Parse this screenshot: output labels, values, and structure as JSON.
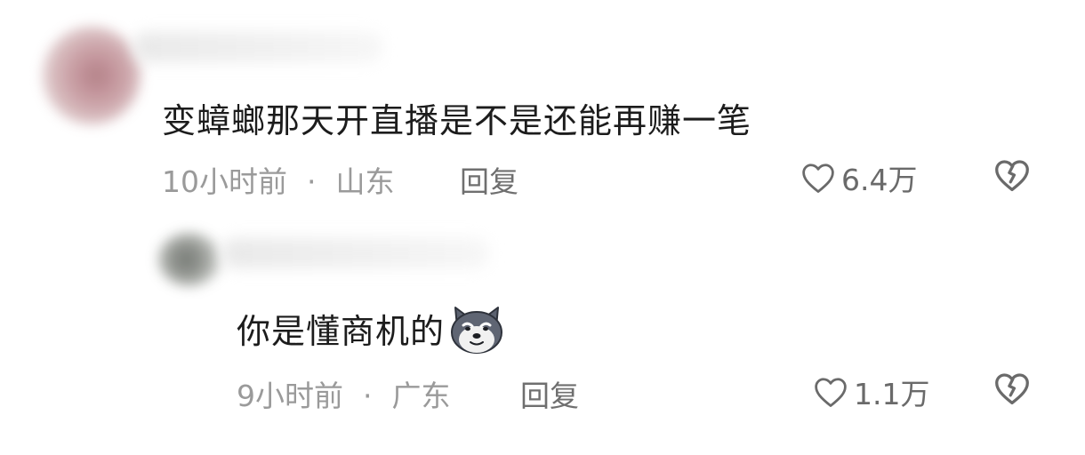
{
  "comments": [
    {
      "text": "变蟑螂那天开直播是不是还能再赚一笔",
      "time": "10小时前",
      "separator": "·",
      "location": "山东",
      "reply_label": "回复",
      "likes": "6.4万"
    },
    {
      "text": "你是懂商机的",
      "emoji": "dog-face-emoji",
      "time": "9小时前",
      "separator": "·",
      "location": "广东",
      "reply_label": "回复",
      "likes": "1.1万"
    }
  ],
  "icons": {
    "like": "heart-outline-icon",
    "dislike": "broken-heart-icon"
  },
  "colors": {
    "text": "#1c1c1c",
    "meta": "#9a9a9a",
    "icon": "#6a6a6a"
  }
}
